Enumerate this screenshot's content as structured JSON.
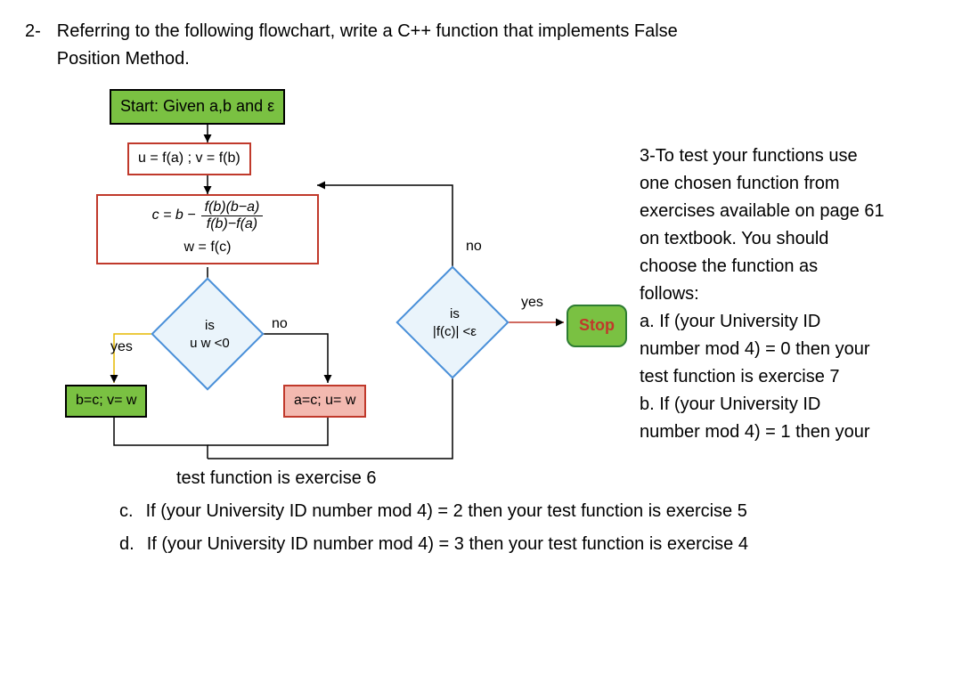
{
  "question": {
    "number": "2-",
    "text_line1": "Referring to the following flowchart, write a C++ function that implements False",
    "text_line2": "Position Method."
  },
  "flowchart": {
    "start": "Start: Given  a,b  and ε",
    "init": "u = f(a) ; v = f(b)",
    "calc_c_prefix": "c = b  − ",
    "calc_c_num": "f(b)(b−a)",
    "calc_c_den": "f(b)−f(a)",
    "calc_w": "w = f(c)",
    "dec1_line1": "is",
    "dec1_line2": "u w <0",
    "dec2_line1": "is",
    "dec2_line2": "|f(c)| <ε",
    "proc_yes": "b=c; v= w",
    "proc_no": "a=c; u= w",
    "stop": "Stop",
    "lbl_yes1": "yes",
    "lbl_no1": "no",
    "lbl_yes2": "yes",
    "lbl_no2": "no"
  },
  "right": {
    "r1": "3-To test your functions use",
    "r2": "one chosen function from",
    "r3": "exercises available on page 61",
    "r4": "on textbook. You should",
    "r5": "choose the function as",
    "r6": "follows:",
    "r7": "a. If (your University ID",
    "r8": "number mod 4) = 0 then your",
    "r9": "test function is exercise 7",
    "r10": "b. If (your University ID",
    "r11": "number mod 4) = 1 then your"
  },
  "bottom": {
    "b1": "test function is exercise 6",
    "c_letter": "c.",
    "c_text": "If (your University ID number mod 4) = 2 then your test function is exercise 5",
    "d_letter": "d.",
    "d_text": "If (your University ID number mod 4) = 3 then your test function is exercise 4"
  }
}
